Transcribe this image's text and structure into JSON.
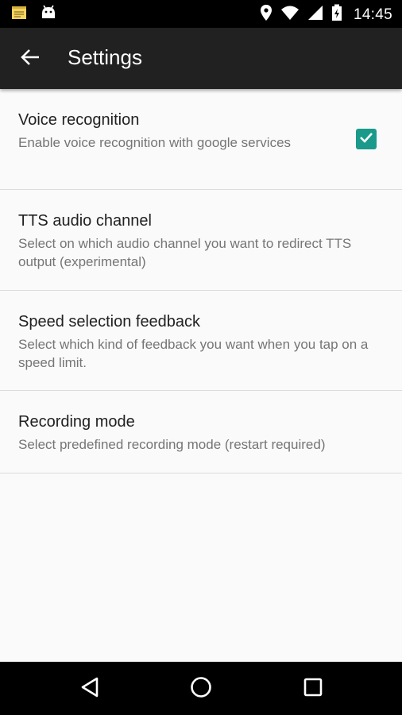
{
  "status_bar": {
    "time": "14:45",
    "icons": [
      "notes-icon",
      "android-icon",
      "location-icon",
      "wifi-icon",
      "signal-icon",
      "battery-icon"
    ]
  },
  "app_bar": {
    "title": "Settings",
    "back_icon": "arrow-back-icon"
  },
  "settings": [
    {
      "title": "Voice recognition",
      "summary": "Enable voice recognition with google services",
      "checked": true
    },
    {
      "title": "TTS audio channel",
      "summary": "Select on which audio channel you want to redirect TTS output (experimental)"
    },
    {
      "title": "Speed selection feedback",
      "summary": "Select which kind of feedback you want when you tap on a speed limit."
    },
    {
      "title": "Recording mode",
      "summary": "Select predefined recording mode (restart required)"
    }
  ],
  "nav_bar": {
    "icons": [
      "back-triangle-icon",
      "home-circle-icon",
      "recents-square-icon"
    ]
  },
  "colors": {
    "accent": "#1a9a8a",
    "app_bar": "#212121",
    "background": "#fafafa"
  }
}
